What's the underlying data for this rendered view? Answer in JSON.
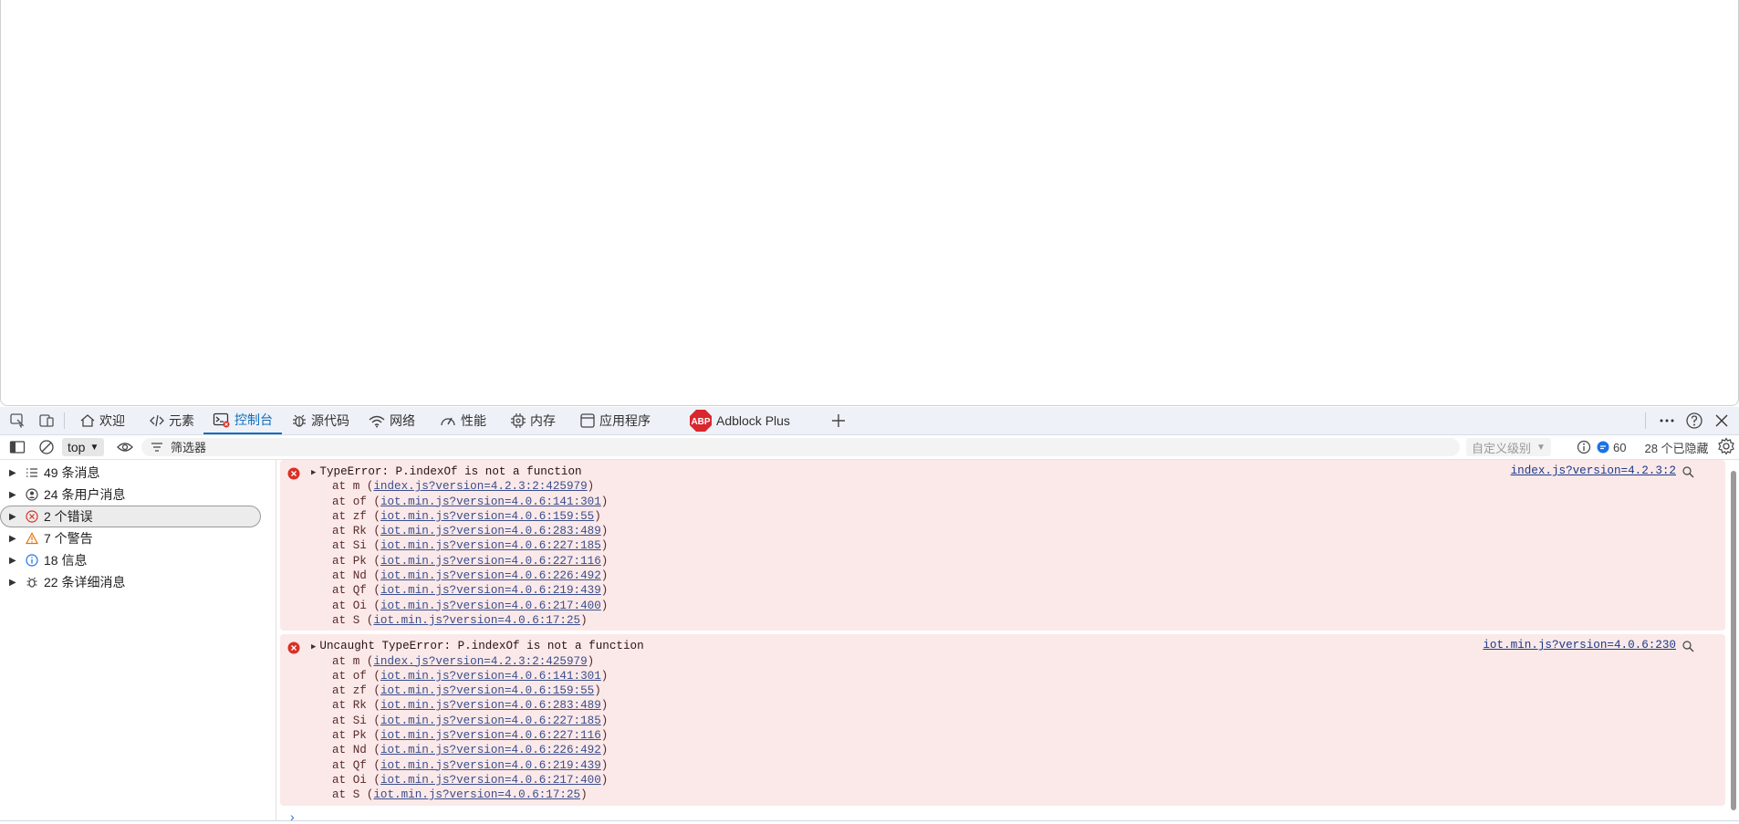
{
  "tabs": [
    {
      "label": "欢迎",
      "icon": "home-icon"
    },
    {
      "label": "元素",
      "icon": "code-icon"
    },
    {
      "label": "控制台",
      "icon": "console-icon",
      "active": true
    },
    {
      "label": "源代码",
      "icon": "bug-icon"
    },
    {
      "label": "网络",
      "icon": "wifi-icon"
    },
    {
      "label": "性能",
      "icon": "gauge-icon"
    },
    {
      "label": "内存",
      "icon": "chip-icon"
    },
    {
      "label": "应用程序",
      "icon": "app-icon"
    },
    {
      "label": "Adblock Plus",
      "icon": "abp-icon",
      "badge": "ABP"
    }
  ],
  "toolbar": {
    "context": "top",
    "filter_placeholder": "筛选器",
    "levels": "自定义级别",
    "issues_count": "60",
    "hidden_label": "28 个已隐藏"
  },
  "sidebar": {
    "items": [
      {
        "label": "49 条消息",
        "icon": "list-icon"
      },
      {
        "label": "24 条用户消息",
        "icon": "user-icon"
      },
      {
        "label": "2 个错误",
        "icon": "error-icon"
      },
      {
        "label": "7 个警告",
        "icon": "warning-icon"
      },
      {
        "label": "18 信息",
        "icon": "info-icon"
      },
      {
        "label": "22 条详细消息",
        "icon": "verbose-icon"
      }
    ]
  },
  "messages": [
    {
      "title": "TypeError: P.indexOf is not a function",
      "source": "index.js?version=4.2.3:2",
      "frames": [
        {
          "fn": "m",
          "loc": "index.js?version=4.2.3:2:425979"
        },
        {
          "fn": "of",
          "loc": "iot.min.js?version=4.0.6:141:301"
        },
        {
          "fn": "zf",
          "loc": "iot.min.js?version=4.0.6:159:55"
        },
        {
          "fn": "Rk",
          "loc": "iot.min.js?version=4.0.6:283:489"
        },
        {
          "fn": "Si",
          "loc": "iot.min.js?version=4.0.6:227:185"
        },
        {
          "fn": "Pk",
          "loc": "iot.min.js?version=4.0.6:227:116"
        },
        {
          "fn": "Nd",
          "loc": "iot.min.js?version=4.0.6:226:492"
        },
        {
          "fn": "Qf",
          "loc": "iot.min.js?version=4.0.6:219:439"
        },
        {
          "fn": "Oi",
          "loc": "iot.min.js?version=4.0.6:217:400"
        },
        {
          "fn": "S",
          "loc": "iot.min.js?version=4.0.6:17:25"
        }
      ]
    },
    {
      "title": "Uncaught TypeError: P.indexOf is not a function",
      "source": "iot.min.js?version=4.0.6:230",
      "frames": [
        {
          "fn": "m",
          "loc": "index.js?version=4.2.3:2:425979"
        },
        {
          "fn": "of",
          "loc": "iot.min.js?version=4.0.6:141:301"
        },
        {
          "fn": "zf",
          "loc": "iot.min.js?version=4.0.6:159:55"
        },
        {
          "fn": "Rk",
          "loc": "iot.min.js?version=4.0.6:283:489"
        },
        {
          "fn": "Si",
          "loc": "iot.min.js?version=4.0.6:227:185"
        },
        {
          "fn": "Pk",
          "loc": "iot.min.js?version=4.0.6:227:116"
        },
        {
          "fn": "Nd",
          "loc": "iot.min.js?version=4.0.6:226:492"
        },
        {
          "fn": "Qf",
          "loc": "iot.min.js?version=4.0.6:219:439"
        },
        {
          "fn": "Oi",
          "loc": "iot.min.js?version=4.0.6:217:400"
        },
        {
          "fn": "S",
          "loc": "iot.min.js?version=4.0.6:17:25"
        }
      ]
    }
  ],
  "colors": {
    "accent": "#0f6cbd",
    "error_bg": "#fbe9e9",
    "error_icon": "#d93025"
  }
}
